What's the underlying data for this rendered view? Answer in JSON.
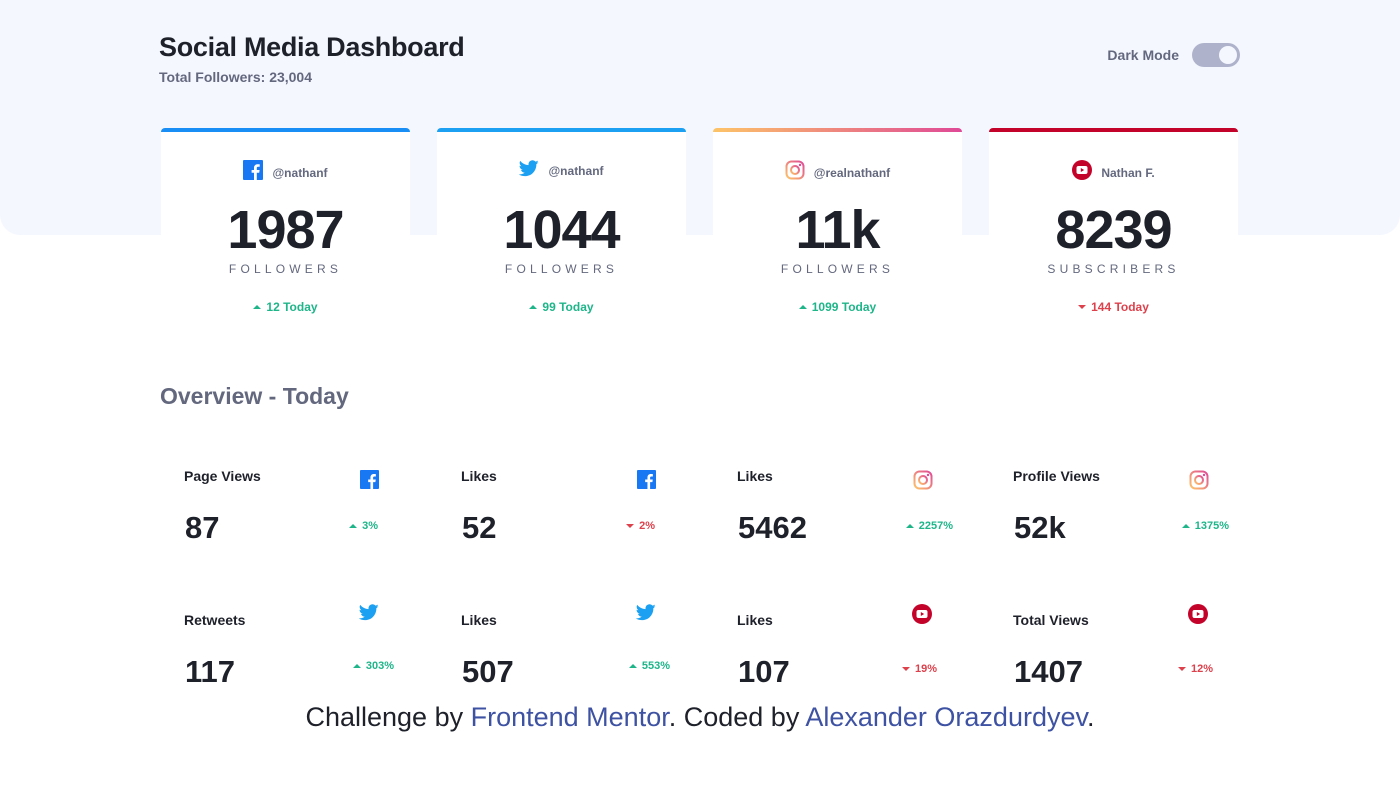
{
  "header": {
    "title": "Social Media Dashboard",
    "total_followers": "Total Followers: 23,004",
    "dark_mode_label": "Dark Mode",
    "dark_mode_on": true
  },
  "colors": {
    "facebook": "#198ff5",
    "twitter": "#1ca0f2",
    "instagram_gradient": [
      "#fdc468",
      "#df4996"
    ],
    "youtube": "#c4032a",
    "up": "#1eb589",
    "down": "#dc414c",
    "link": "#3e52a3"
  },
  "cards": [
    {
      "network": "facebook",
      "icon": "facebook-icon",
      "handle": "@nathanf",
      "count": "1987",
      "label": "FOLLOWERS",
      "change": "12 Today",
      "trend": "up"
    },
    {
      "network": "twitter",
      "icon": "twitter-icon",
      "handle": "@nathanf",
      "count": "1044",
      "label": "FOLLOWERS",
      "change": "99 Today",
      "trend": "up"
    },
    {
      "network": "instagram",
      "icon": "instagram-icon",
      "handle": "@realnathanf",
      "count": "11k",
      "label": "FOLLOWERS",
      "change": "1099 Today",
      "trend": "up"
    },
    {
      "network": "youtube",
      "icon": "youtube-icon",
      "handle": "Nathan F.",
      "count": "8239",
      "label": "SUBSCRIBERS",
      "change": "144 Today",
      "trend": "down"
    }
  ],
  "overview": {
    "title": "Overview - Today",
    "items": [
      {
        "label": "Page Views",
        "icon": "facebook-icon",
        "value": "87",
        "change": "3%",
        "trend": "up"
      },
      {
        "label": "Likes",
        "icon": "facebook-icon",
        "value": "52",
        "change": "2%",
        "trend": "down"
      },
      {
        "label": "Likes",
        "icon": "instagram-icon",
        "value": "5462",
        "change": "2257%",
        "trend": "up"
      },
      {
        "label": "Profile Views",
        "icon": "instagram-icon",
        "value": "52k",
        "change": "1375%",
        "trend": "up"
      },
      {
        "label": "Retweets",
        "icon": "twitter-icon",
        "value": "117",
        "change": "303%",
        "trend": "up"
      },
      {
        "label": "Likes",
        "icon": "twitter-icon",
        "value": "507",
        "change": "553%",
        "trend": "up"
      },
      {
        "label": "Likes",
        "icon": "youtube-icon",
        "value": "107",
        "change": "19%",
        "trend": "down"
      },
      {
        "label": "Total Views",
        "icon": "youtube-icon",
        "value": "1407",
        "change": "12%",
        "trend": "down"
      }
    ]
  },
  "footer": {
    "prefix": "Challenge by ",
    "link1": "Frontend Mentor",
    "middle": ". Coded by ",
    "link2": "Alexander Orazdurdyev",
    "suffix": "."
  }
}
